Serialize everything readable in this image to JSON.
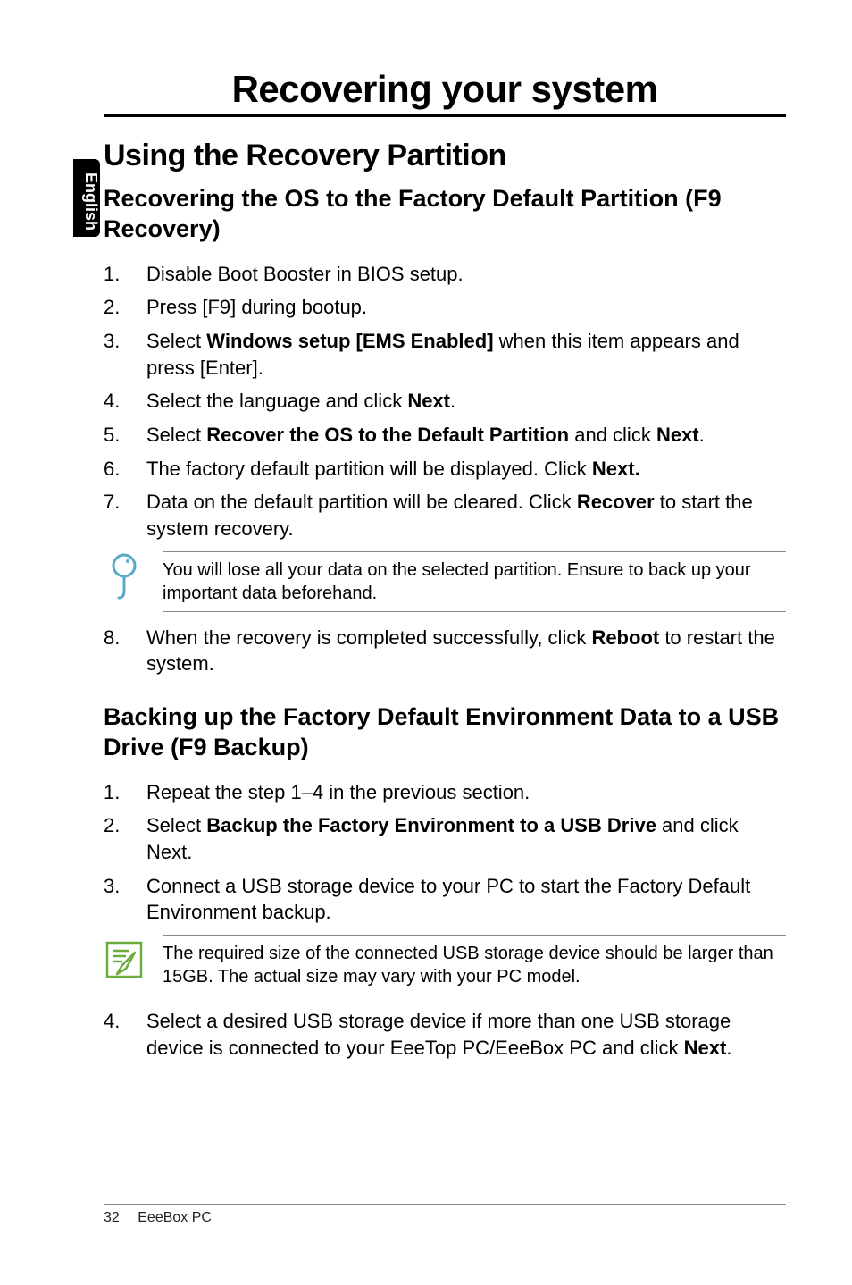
{
  "sideTab": "English",
  "title": "Recovering your system",
  "h2": "Using the Recovery Partition",
  "section1": {
    "heading": "Recovering the OS to the Factory Default Partition (F9 Recovery)",
    "items": [
      "Disable Boot Booster in BIOS setup.",
      "Press [F9] during bootup.",
      "Select <b>Windows setup [EMS Enabled]</b> when this item appears and press [Enter].",
      "Select the language and click <b>Next</b>.",
      "Select <b>Recover the OS to the Default Partition</b> and click <b>Next</b>.",
      "The factory default partition will be displayed. Click <b>Next.</b>",
      "Data on the default partition will be cleared. Click <b>Recover</b> to start the system recovery."
    ],
    "note": "You will lose all your data on the selected partition. Ensure to back up your important data beforehand.",
    "item8": "When the recovery is completed successfully, click <b>Reboot</b> to restart the system."
  },
  "section2": {
    "heading": "Backing up the Factory Default Environment Data to a USB Drive (F9 Backup)",
    "items": [
      "Repeat the step 1–4 in the previous section.",
      "Select <b>Backup the Factory Environment to a USB Drive</b> and click Next.",
      "Connect a USB storage device to your PC to start the Factory Default Environment backup."
    ],
    "note": "The required size of the connected USB storage device should be larger than 15GB. The actual size may vary with your PC model.",
    "item4": "Select a desired USB storage device if more than one USB storage device is connected to your EeeTop PC/EeeBox PC and click <b>Next</b>."
  },
  "footer": {
    "page": "32",
    "label": "EeeBox PC"
  },
  "icons": {
    "tip": "tip-icon",
    "note": "note-icon"
  }
}
